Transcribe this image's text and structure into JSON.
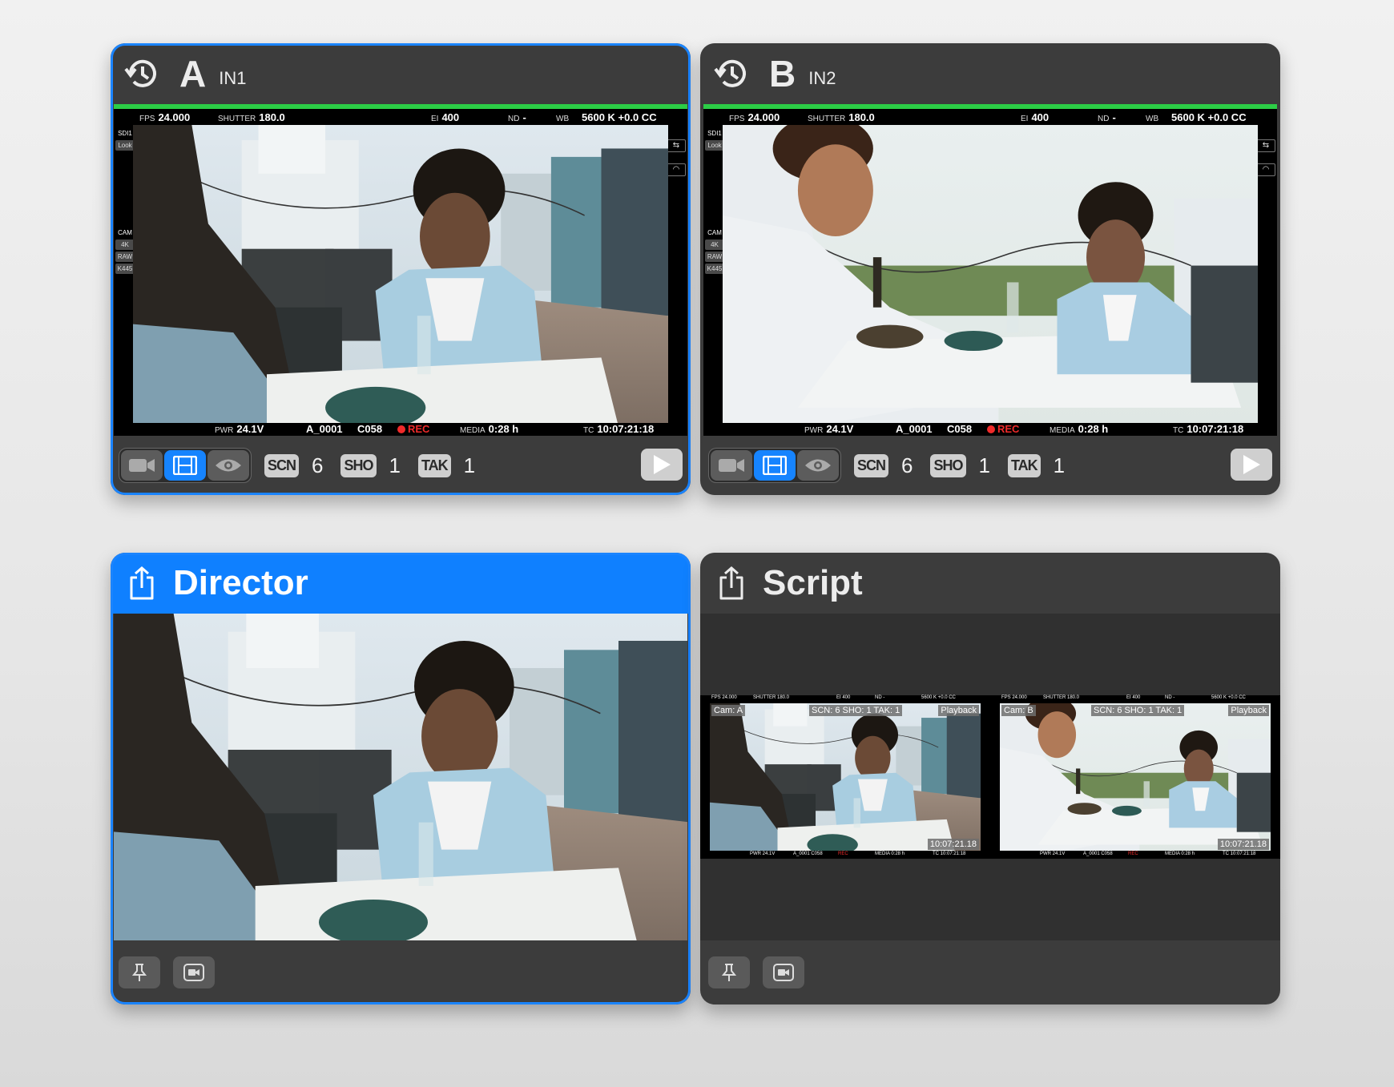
{
  "colors": {
    "accent": "#0f80ff",
    "tally_green": "#2ccd46",
    "rec_red": "#f12a2a",
    "panel_bg": "#3c3c3c"
  },
  "cameras": [
    {
      "letter": "A",
      "input": "IN1",
      "fps_label": "FPS",
      "fps": "24.000",
      "shutter_label": "SHUTTER",
      "shutter": "180.0",
      "ei_label": "EI",
      "ei": "400",
      "nd_label": "ND",
      "nd": "-",
      "wb_label": "WB",
      "wb": "5600 K +0.0 CC",
      "pwr_label": "PWR",
      "pwr": "24.1V",
      "clip": "A_0001",
      "clip2": "C058",
      "rec": "REC",
      "media_label": "MEDIA",
      "media": "0:28 h",
      "tc_label": "TC",
      "tc": "10:07:21:18",
      "left_top": [
        "SDI1",
        "Look"
      ],
      "left_mid": [
        "CAM",
        "4K",
        "RAW",
        "K445"
      ],
      "scn_label": "SCN",
      "scn": "6",
      "sho_label": "SHO",
      "sho": "1",
      "tak_label": "TAK",
      "tak": "1",
      "selected": true
    },
    {
      "letter": "B",
      "input": "IN2",
      "fps_label": "FPS",
      "fps": "24.000",
      "shutter_label": "SHUTTER",
      "shutter": "180.0",
      "ei_label": "EI",
      "ei": "400",
      "nd_label": "ND",
      "nd": "-",
      "wb_label": "WB",
      "wb": "5600 K +0.0 CC",
      "pwr_label": "PWR",
      "pwr": "24.1V",
      "clip": "A_0001",
      "clip2": "C058",
      "rec": "REC",
      "media_label": "MEDIA",
      "media": "0:28 h",
      "tc_label": "TC",
      "tc": "10:07:21:18",
      "left_top": [
        "SDI1",
        "Look"
      ],
      "left_mid": [
        "CAM",
        "4K",
        "RAW",
        "K445"
      ],
      "scn_label": "SCN",
      "scn": "6",
      "sho_label": "SHO",
      "sho": "1",
      "tak_label": "TAK",
      "tak": "1",
      "selected": false
    }
  ],
  "mode_icons": [
    "video-camera-icon",
    "film-strip-icon",
    "eye-icon"
  ],
  "director": {
    "title": "Director",
    "icon": "share-icon"
  },
  "script": {
    "title": "Script",
    "icon": "share-icon",
    "thumbs": [
      {
        "cam": "Cam: A",
        "shot": "SCN: 6 SHO: 1 TAK: 1",
        "mode": "Playback",
        "tc": "10:07:21.18",
        "top": [
          "FPS 24.000",
          "SHUTTER 180.0",
          "EI 400",
          "ND -",
          "5600 K +0.0 CC"
        ],
        "bottom": [
          "PWR 24.1V",
          "A_0001 C058",
          "REC",
          "MEDIA 0:28 h",
          "TC 10:07:21:18"
        ]
      },
      {
        "cam": "Cam: B",
        "shot": "SCN: 6 SHO: 1 TAK: 1",
        "mode": "Playback",
        "tc": "10:07:21.18",
        "top": [
          "FPS 24.000",
          "SHUTTER 180.0",
          "EI 400",
          "ND -",
          "5600 K +0.0 CC"
        ],
        "bottom": [
          "PWR 24.1V",
          "A_0001 C058",
          "REC",
          "MEDIA 0:28 h",
          "TC 10:07:21:18"
        ]
      }
    ]
  },
  "footer_icons": [
    "pin-icon",
    "camera-frame-icon"
  ]
}
